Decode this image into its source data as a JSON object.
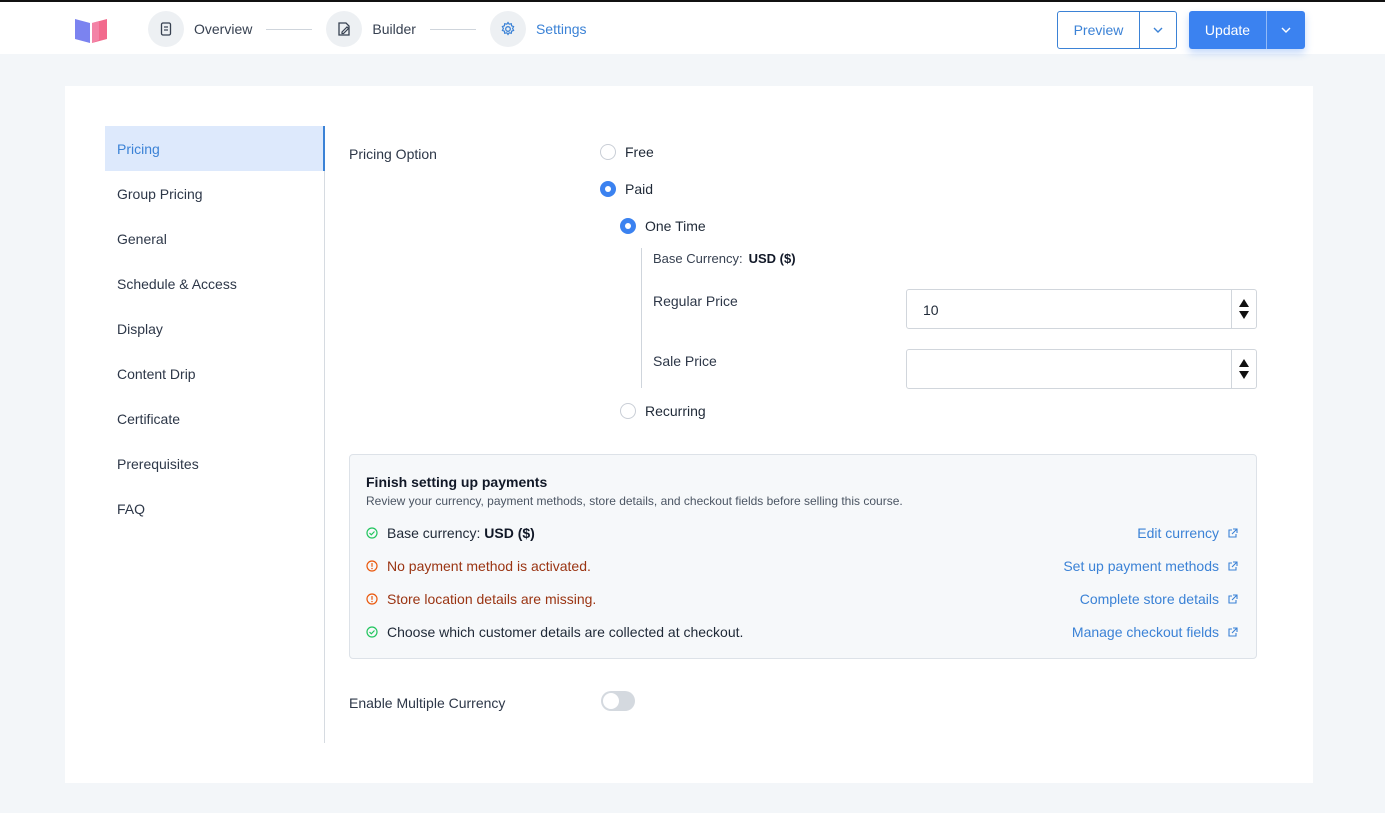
{
  "header": {
    "steps": [
      {
        "label": "Overview",
        "icon": "document-icon"
      },
      {
        "label": "Builder",
        "icon": "edit-icon"
      },
      {
        "label": "Settings",
        "icon": "gear-icon"
      }
    ],
    "preview_label": "Preview",
    "update_label": "Update"
  },
  "sidebar": {
    "items": [
      {
        "label": "Pricing",
        "active": true
      },
      {
        "label": "Group Pricing"
      },
      {
        "label": "General"
      },
      {
        "label": "Schedule & Access"
      },
      {
        "label": "Display"
      },
      {
        "label": "Content Drip"
      },
      {
        "label": "Certificate"
      },
      {
        "label": "Prerequisites"
      },
      {
        "label": "FAQ"
      }
    ]
  },
  "pricing": {
    "option_label": "Pricing Option",
    "free_label": "Free",
    "paid_label": "Paid",
    "one_time_label": "One Time",
    "recurring_label": "Recurring",
    "selected": "Paid",
    "selected_sub": "One Time",
    "base_currency_label": "Base Currency:",
    "base_currency_value": "USD ($)",
    "regular_price_label": "Regular Price",
    "regular_price_value": "10",
    "sale_price_label": "Sale Price",
    "sale_price_value": ""
  },
  "payments_panel": {
    "title": "Finish setting up payments",
    "subtitle": "Review your currency, payment methods, store details, and checkout fields before selling this course.",
    "rows": [
      {
        "status": "ok",
        "text_prefix": "Base currency: ",
        "text_bold": "USD ($)",
        "link": "Edit currency"
      },
      {
        "status": "warn",
        "text_prefix": "No payment method is activated.",
        "text_bold": "",
        "link": "Set up payment methods"
      },
      {
        "status": "warn",
        "text_prefix": "Store location details are missing.",
        "text_bold": "",
        "link": "Complete store details"
      },
      {
        "status": "ok",
        "text_prefix": "Choose which customer details are collected at checkout.",
        "text_bold": "",
        "link": "Manage checkout fields"
      }
    ]
  },
  "multi_currency": {
    "label": "Enable Multiple Currency",
    "enabled": false
  },
  "colors": {
    "accent": "#3b82f0",
    "ok": "#22c55e",
    "warn": "#ea580c"
  }
}
